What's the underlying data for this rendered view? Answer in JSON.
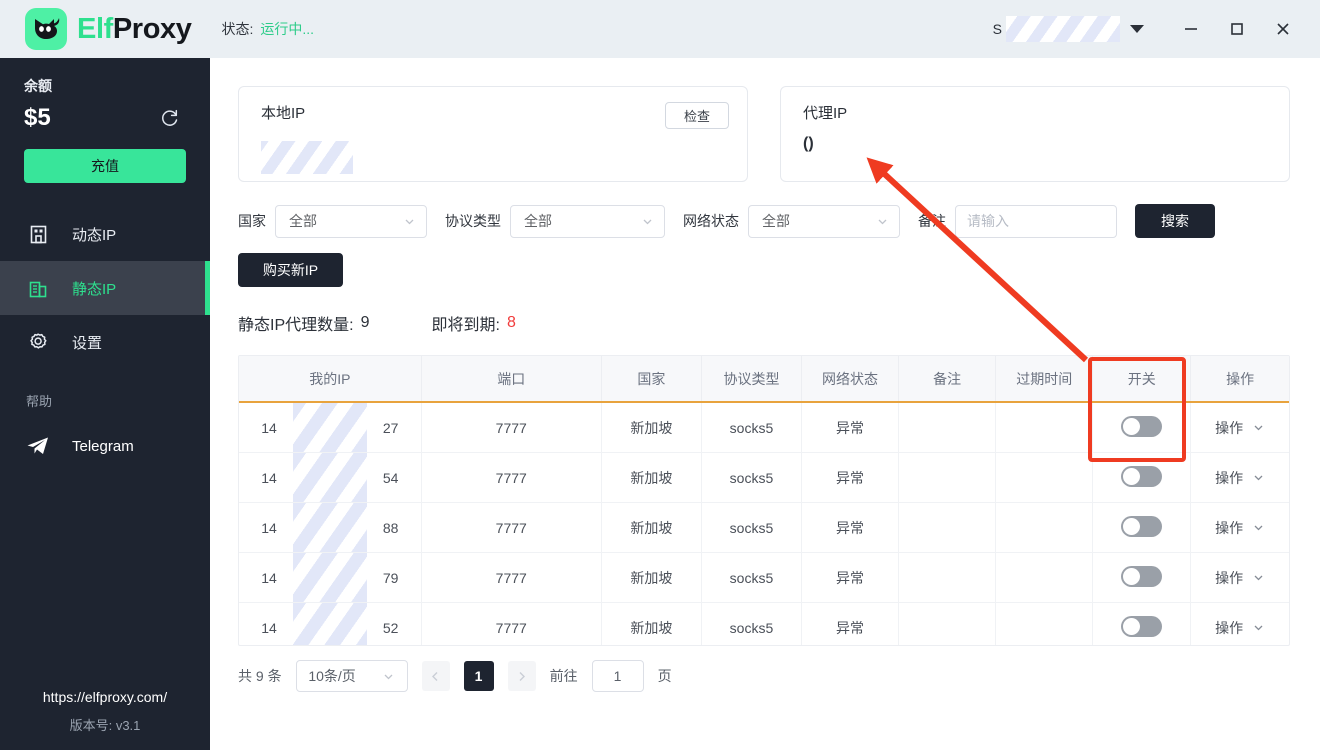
{
  "titlebar": {
    "logo_icon": "cat-logo-icon",
    "brand_first": "Elf",
    "brand_second": "Proxy",
    "status_label": "状态:",
    "status_value": "运行中...",
    "account_name": "S",
    "account_redacted": true,
    "minimize_icon": "minimize-icon",
    "maximize_icon": "maximize-icon",
    "close_icon": "close-icon"
  },
  "sidebar": {
    "balance_label": "余额",
    "balance_amount": "$5",
    "refresh_icon": "refresh-icon",
    "topup_label": "充值",
    "items": [
      {
        "label": "动态IP",
        "icon": "building-icon",
        "active": false
      },
      {
        "label": "静态IP",
        "icon": "building-icon",
        "active": true
      },
      {
        "label": "设置",
        "icon": "gear-icon",
        "active": false
      }
    ],
    "help_label": "帮助",
    "telegram_label": "Telegram",
    "telegram_icon": "telegram-icon",
    "site_url": "https://elfproxy.com/",
    "version": "版本号: v3.1",
    "accent_color": "#2ee08e",
    "background_color": "#1e2430"
  },
  "cards": {
    "local": {
      "title": "本地IP",
      "value": "",
      "value_redacted": true,
      "button_label": "检查"
    },
    "proxy": {
      "title": "代理IP",
      "value": "()"
    }
  },
  "filters": {
    "country": {
      "label": "国家",
      "value": "全部"
    },
    "protocol": {
      "label": "协议类型",
      "value": "全部"
    },
    "network": {
      "label": "网络状态",
      "value": "全部"
    },
    "remark": {
      "label": "备注",
      "value": "",
      "placeholder": "请输入"
    },
    "search_label": "搜索",
    "buy_label": "购买新IP"
  },
  "stats": {
    "count_label": "静态IP代理数量:",
    "count_value": "9",
    "expiring_label": "即将到期:",
    "expiring_value": "8",
    "expiring_color": "#f13c3c"
  },
  "table": {
    "columns": [
      "我的IP",
      "端口",
      "国家",
      "协议类型",
      "网络状态",
      "备注",
      "过期时间",
      "开关",
      "操作"
    ],
    "action_label": "操作",
    "rows": [
      {
        "ip_prefix": "14",
        "ip_suffix": "27",
        "port": "7777",
        "country": "新加坡",
        "protocol": "socks5",
        "network": "异常",
        "remark": "",
        "expire": "",
        "enabled": false
      },
      {
        "ip_prefix": "14",
        "ip_suffix": "54",
        "port": "7777",
        "country": "新加坡",
        "protocol": "socks5",
        "network": "异常",
        "remark": "",
        "expire": "",
        "enabled": false
      },
      {
        "ip_prefix": "14",
        "ip_suffix": "88",
        "port": "7777",
        "country": "新加坡",
        "protocol": "socks5",
        "network": "异常",
        "remark": "",
        "expire": "",
        "enabled": false
      },
      {
        "ip_prefix": "14",
        "ip_suffix": "79",
        "port": "7777",
        "country": "新加坡",
        "protocol": "socks5",
        "network": "异常",
        "remark": "",
        "expire": "",
        "enabled": false
      },
      {
        "ip_prefix": "14",
        "ip_suffix": "52",
        "port": "7777",
        "country": "新加坡",
        "protocol": "socks5",
        "network": "异常",
        "remark": "",
        "expire": "",
        "enabled": false
      }
    ]
  },
  "pagination": {
    "total_label": "共 9 条",
    "page_size": "10条/页",
    "prev_icon": "chevron-left-icon",
    "next_icon": "chevron-right-icon",
    "current_page": "1",
    "goto_label": "前往",
    "goto_value": "1",
    "page_unit": "页"
  },
  "annotations": {
    "highlight_color": "#ef3b21",
    "box_target": "开关-column-toggle",
    "arrow_target": "代理IP-card"
  }
}
